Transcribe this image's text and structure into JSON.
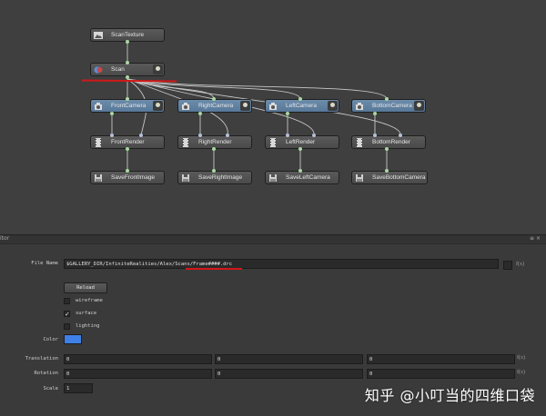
{
  "graph": {
    "nodes": {
      "scan_texture": "ScanTexture",
      "scan": "Scan",
      "front_camera": "FrontCamera",
      "right_camera": "RightCamera",
      "left_camera": "LeftCamera",
      "bottom_camera": "BottomCamera",
      "front_render": "FrontRender",
      "right_render": "RightRender",
      "left_render": "LeftRender",
      "bottom_render": "BottomRender",
      "save_front": "SaveFrontImage",
      "save_right": "SaveRightImage",
      "save_left": "SaveLeftCamera",
      "save_bottom": "SaveBottomCamera"
    }
  },
  "editor": {
    "title": "itor",
    "controls": "≡ ×",
    "file_name_label": "File Name",
    "file_name_value": "$GALLERY_DIR/InfiniteRealities/Alex/Scans/Frame####.drc",
    "fx_label": "f(x)",
    "reload_label": "Reload",
    "wireframe_label": "wireframe",
    "wireframe_checked": false,
    "surface_label": "surface",
    "surface_checked": true,
    "surface_check_glyph": "✓",
    "lighting_label": "lighting",
    "lighting_checked": false,
    "color_label": "Color",
    "color_value": "#3f7fe8",
    "translation_label": "Translation",
    "translation_values": [
      "0",
      "0",
      "0"
    ],
    "rotation_label": "Rotation",
    "rotation_values": [
      "0",
      "0",
      "0"
    ],
    "scale_label": "Scale",
    "scale_value": "1"
  },
  "watermark": "知乎 @小叮当的四维口袋",
  "colors": {
    "camera_node": "#6383a4",
    "annotation_red": "#d21818",
    "wire": "#c8c8c8",
    "green_port": "#a9d8a2"
  }
}
